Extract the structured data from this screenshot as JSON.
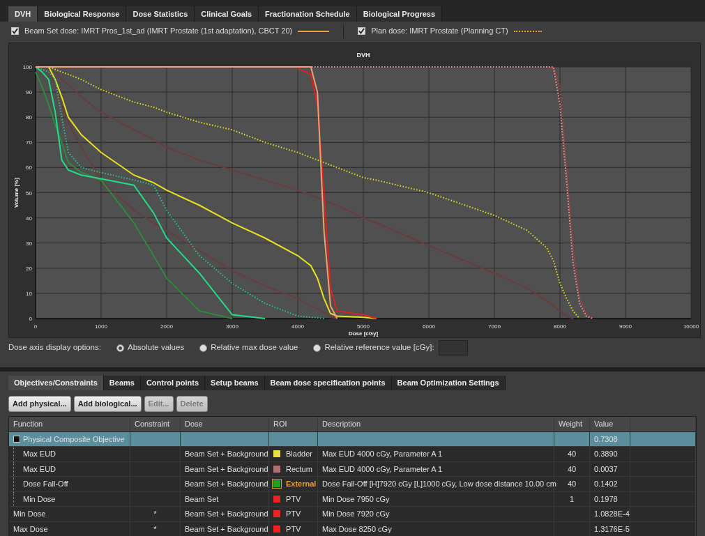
{
  "top_tabs": [
    {
      "label": "DVH",
      "selected": true
    },
    {
      "label": "Biological Response",
      "selected": false
    },
    {
      "label": "Dose Statistics",
      "selected": false
    },
    {
      "label": "Clinical Goals",
      "selected": false
    },
    {
      "label": "Fractionation Schedule",
      "selected": false
    },
    {
      "label": "Biological Progress",
      "selected": false
    }
  ],
  "dose_toggles": [
    {
      "label": "Beam Set dose: IMRT Pros_1st_ad (IMRT Prostate (1st adaptation), CBCT 20)",
      "checked": true,
      "kind": "solid"
    },
    {
      "label": "Plan dose: IMRT Prostate (Planning CT)",
      "checked": true,
      "kind": "dotted"
    }
  ],
  "dvh": {
    "chart_data": {
      "type": "line",
      "title": "DVH",
      "xlabel": "Dose [cGy]",
      "ylabel": "Volume [%]",
      "grid": true,
      "x": [
        0,
        100,
        200,
        300,
        400,
        500,
        700,
        1000,
        1500,
        1800,
        2000,
        2500,
        3000,
        3500,
        4000,
        4200,
        4300,
        4400,
        4500,
        4600,
        5000,
        5200,
        6000,
        7000,
        7500,
        7800,
        7900,
        8000,
        8100,
        8200,
        8300,
        8400,
        8500
      ],
      "xlim": [
        0,
        10000
      ],
      "ylim": [
        0,
        100
      ],
      "xticks": [
        0,
        1000,
        2000,
        3000,
        4000,
        5000,
        6000,
        7000,
        8000,
        9000,
        10000
      ],
      "yticks": [
        0,
        10,
        20,
        30,
        40,
        50,
        60,
        70,
        80,
        90,
        100
      ],
      "series": [
        {
          "line_style": "solid",
          "color": "#6a3c3c",
          "values": [
            null,
            null,
            null,
            98,
            95,
            93,
            88,
            82,
            75,
            71,
            68,
            63,
            59,
            55,
            51,
            49,
            48,
            47,
            46,
            45,
            40,
            38,
            29,
            18,
            12,
            7,
            5,
            3,
            1,
            0,
            null,
            null,
            null
          ]
        },
        {
          "line_style": "solid",
          "color": "#6a3c3c",
          "values": [
            null,
            null,
            99,
            93,
            85,
            78,
            68,
            55,
            43,
            38,
            35,
            27,
            19,
            13,
            8,
            5,
            4,
            2.5,
            0.5,
            0,
            null,
            null,
            null,
            null,
            null,
            null,
            null,
            null,
            null,
            null,
            null,
            null,
            null
          ]
        },
        {
          "line_style": "solid",
          "color": "#2e8b3e",
          "values": [
            98,
            92,
            85,
            77,
            70,
            62,
            58,
            55,
            38,
            25,
            16,
            3,
            0,
            null,
            null,
            null,
            null,
            null,
            null,
            null,
            null,
            null,
            null,
            null,
            null,
            null,
            null,
            null,
            null,
            null,
            null,
            null,
            null
          ]
        },
        {
          "line_style": "solid",
          "color": "#22dd88",
          "values": [
            100,
            98,
            95,
            82,
            63,
            59,
            57,
            55.5,
            53,
            42,
            32,
            18,
            1.5,
            0,
            null,
            null,
            null,
            null,
            null,
            null,
            null,
            null,
            null,
            null,
            null,
            null,
            null,
            null,
            null,
            null,
            null,
            null,
            null
          ]
        },
        {
          "line_style": "solid",
          "color": "#e8e020",
          "values": [
            null,
            null,
            100,
            95,
            88,
            80,
            73,
            66,
            57,
            54,
            51,
            45,
            38,
            32,
            25,
            21,
            16,
            8,
            2,
            1,
            0.5,
            0,
            null,
            null,
            null,
            null,
            null,
            null,
            null,
            null,
            null,
            null,
            null
          ]
        },
        {
          "line_style": "solid",
          "color": "#dd2222",
          "values": [
            null,
            null,
            null,
            null,
            null,
            null,
            null,
            null,
            null,
            null,
            null,
            null,
            null,
            null,
            99.5,
            97,
            85,
            50,
            12,
            3,
            1.5,
            0,
            null,
            null,
            null,
            null,
            null,
            null,
            null,
            null,
            null,
            null,
            null
          ]
        },
        {
          "line_style": "solid",
          "color": "#f0a070",
          "values": [
            100,
            100,
            100,
            100,
            100,
            100,
            100,
            100,
            100,
            100,
            100,
            100,
            100,
            100,
            100,
            100,
            90,
            35,
            5,
            0,
            null,
            null,
            null,
            null,
            null,
            null,
            null,
            null,
            null,
            null,
            null,
            null,
            null
          ]
        },
        {
          "line_style": "dotted",
          "color": "#e8e020",
          "values": [
            100,
            100,
            100,
            99,
            98,
            97,
            95,
            91,
            86,
            84,
            82,
            78,
            75,
            70,
            66,
            64,
            63,
            62,
            61,
            60,
            56,
            55,
            50,
            41,
            35,
            28,
            23,
            14,
            8,
            3,
            0,
            null,
            null
          ]
        },
        {
          "line_style": "dotted",
          "color": "#22cc88",
          "values": [
            100,
            99,
            98,
            95,
            80,
            66,
            60,
            58,
            55,
            53,
            43,
            25,
            14,
            6,
            1,
            0.5,
            0.3,
            0,
            null,
            null,
            null,
            null,
            null,
            null,
            null,
            null,
            null,
            null,
            null,
            null,
            null,
            null,
            null
          ]
        },
        {
          "line_style": "dotted",
          "color": "#dd3333",
          "values": [
            null,
            null,
            null,
            null,
            null,
            null,
            null,
            null,
            null,
            null,
            null,
            null,
            null,
            null,
            null,
            null,
            null,
            null,
            null,
            null,
            null,
            null,
            null,
            null,
            null,
            100,
            99.5,
            92,
            60,
            28,
            8,
            2,
            0
          ]
        },
        {
          "line_style": "dotted",
          "color": "#f0a0a0",
          "values": [
            100,
            100,
            100,
            100,
            100,
            100,
            100,
            100,
            100,
            100,
            100,
            100,
            100,
            100,
            100,
            100,
            100,
            100,
            100,
            100,
            100,
            100,
            100,
            100,
            100,
            100,
            100,
            85,
            55,
            22,
            6,
            1,
            0
          ]
        }
      ]
    }
  },
  "axis_options": {
    "label": "Dose axis display options:",
    "options": [
      {
        "label": "Absolute values",
        "selected": true
      },
      {
        "label": "Relative max dose value",
        "selected": false
      },
      {
        "label": "Relative reference value [cGy]:",
        "selected": false
      }
    ]
  },
  "bottom_tabs": [
    {
      "label": "Objectives/Constraints",
      "selected": true
    },
    {
      "label": "Beams",
      "selected": false
    },
    {
      "label": "Control points",
      "selected": false
    },
    {
      "label": "Setup beams",
      "selected": false
    },
    {
      "label": "Beam dose specification points",
      "selected": false
    },
    {
      "label": "Beam Optimization Settings",
      "selected": false
    }
  ],
  "buttons": [
    {
      "label": "Add physical...",
      "disabled": false
    },
    {
      "label": "Add biological...",
      "disabled": false
    },
    {
      "label": "Edit...",
      "disabled": true
    },
    {
      "label": "Delete",
      "disabled": true
    }
  ],
  "table": {
    "columns": [
      "Function",
      "Constraint",
      "Dose",
      "ROI",
      "Description",
      "Weight",
      "Value"
    ],
    "rows": [
      {
        "function": "Physical Composite Objective",
        "value": "0.7308",
        "selected": true,
        "children": [
          {
            "function": "Max EUD",
            "dose": "Beam Set + Background",
            "roi": {
              "name": "Bladder",
              "color": "#e8e040",
              "highlight": false
            },
            "description": "Max EUD 4000 cGy, Parameter A 1",
            "weight": "40",
            "value": "0.3890",
            "selected": false
          },
          {
            "function": "Max EUD",
            "dose": "Beam Set + Background",
            "roi": {
              "name": "Rectum",
              "color": "#b07070",
              "highlight": false
            },
            "description": "Max EUD 4000 cGy, Parameter A 1",
            "weight": "40",
            "value": "0.0037",
            "selected": false
          },
          {
            "function": "Dose Fall-Off",
            "dose": "Beam Set + Background",
            "roi": {
              "name": "External",
              "color": "#22a022",
              "highlight": true
            },
            "description": "Dose Fall-Off [H]7920 cGy [L]1000 cGy, Low dose distance 10.00 cm",
            "weight": "40",
            "value": "0.1402",
            "selected": false
          },
          {
            "function": "Min Dose",
            "dose": "Beam Set",
            "roi": {
              "name": "PTV",
              "color": "#ee2222",
              "highlight": false
            },
            "description": "Min Dose 7950 cGy",
            "weight": "1",
            "value": "0.1978",
            "selected": false
          }
        ]
      },
      {
        "function": "Min Dose",
        "constraint": "*",
        "dose": "Beam Set + Background",
        "roi": {
          "name": "PTV",
          "color": "#ee2222",
          "highlight": false
        },
        "description": "Min Dose 7920 cGy",
        "value": "1.0828E-4",
        "selected": false
      },
      {
        "function": "Max Dose",
        "constraint": "*",
        "dose": "Beam Set + Background",
        "roi": {
          "name": "PTV",
          "color": "#ee2222",
          "highlight": false
        },
        "description": "Max Dose 8250 cGy",
        "value": "1.3176E-5",
        "selected": false
      }
    ]
  }
}
